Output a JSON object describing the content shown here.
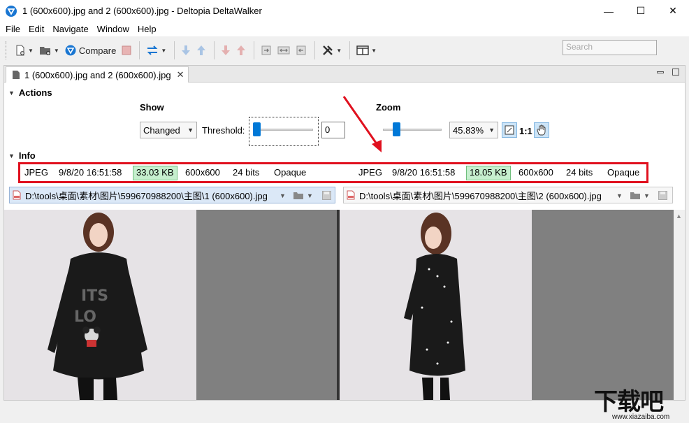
{
  "window": {
    "title": "1 (600x600).jpg and 2 (600x600).jpg - Deltopia DeltaWalker",
    "minimize": "—",
    "maximize": "☐",
    "close": "✕"
  },
  "menu": [
    "File",
    "Edit",
    "Navigate",
    "Window",
    "Help"
  ],
  "toolbar": {
    "compare_label": "Compare",
    "search_placeholder": "Search"
  },
  "tab": {
    "label": "1 (600x600).jpg and 2 (600x600).jpg",
    "close": "✕"
  },
  "actions": {
    "heading": "Actions",
    "show_label": "Show",
    "show_value": "Changed",
    "threshold_label": "Threshold:",
    "threshold_value": "0",
    "threshold_level": 0,
    "zoom_label": "Zoom",
    "zoom_value": "45.83%",
    "zoom_one_to_one": "1:1"
  },
  "info": {
    "heading": "Info",
    "left": {
      "format": "JPEG",
      "date": "9/8/20 16:51:58",
      "size": "33.03 KB",
      "dims": "600x600",
      "bits": "24 bits",
      "alpha": "Opaque"
    },
    "right": {
      "format": "JPEG",
      "date": "9/8/20 16:51:58",
      "size": "18.05 KB",
      "dims": "600x600",
      "bits": "24 bits",
      "alpha": "Opaque"
    }
  },
  "paths": {
    "left": "D:\\tools\\桌面\\素材\\图片\\599670988200\\主图\\1 (600x600).jpg",
    "right": "D:\\tools\\桌面\\素材\\图片\\599670988200\\主图\\2 (600x600).jpg"
  },
  "watermark": {
    "main": "下载吧",
    "sub": "www.xiazaiba.com"
  },
  "colors": {
    "accent": "#0078d7",
    "highlight_border": "#e0101e",
    "size_badge": "#c6efce"
  }
}
